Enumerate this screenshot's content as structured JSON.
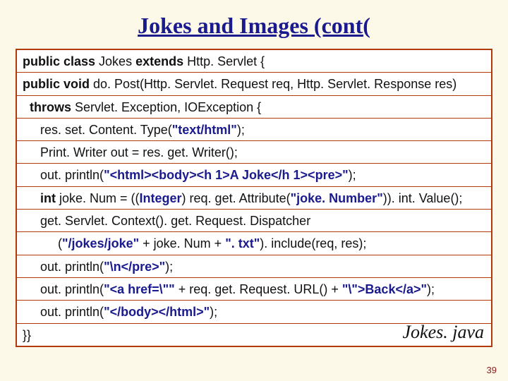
{
  "title": "Jokes and Images (cont(",
  "caption": "Jokes. java",
  "page_number": "39",
  "code": {
    "l1": {
      "a": "public class ",
      "b": "Jokes ",
      "c": "extends ",
      "d": "Http. Servlet {"
    },
    "l2": {
      "a": "public void ",
      "b": "do. Post(Http. Servlet. Request req, Http. Servlet. Response res)"
    },
    "l3": {
      "a": "  throws ",
      "b": "Servlet. Exception, IOException {"
    },
    "l4": {
      "a": "     res. set. Content. Type(",
      "b": "\"text/html\"",
      "c": ");"
    },
    "l5": {
      "a": "     Print. Writer ",
      "b": "out = res. get. Writer();"
    },
    "l6": {
      "a": "     out. println(",
      "b": "\"<html><body><h 1>A Joke</h 1><pre>\"",
      "c": ");"
    },
    "l7": {
      "a": "     int ",
      "b": "joke. Num = ((",
      "c": "Integer",
      "d": ") req. get. Attribute(",
      "e": "\"joke. Number\"",
      "f": ")). int. Value();"
    },
    "l8": {
      "a": "     get. Servlet. Context(). get. Request. Dispatcher"
    },
    "l9": {
      "a": "          (",
      "b": "\"/jokes/joke\"",
      "c": " + joke. Num + ",
      "d": "\". txt\"",
      "e": "). include(req, res);"
    },
    "l10": {
      "a": "     out. println(",
      "b": "\"\\n</pre>\"",
      "c": ");"
    },
    "l11": {
      "a": "     out. println(",
      "b": "\"<a href=\\\"\"",
      "c": " + req. get. Request. URL() + ",
      "d": "\"\\\">Back</a>\"",
      "e": ");"
    },
    "l12": {
      "a": "     out. println(",
      "b": "\"</body></html>\"",
      "c": ");"
    },
    "l13": {
      "a": "}}"
    }
  }
}
